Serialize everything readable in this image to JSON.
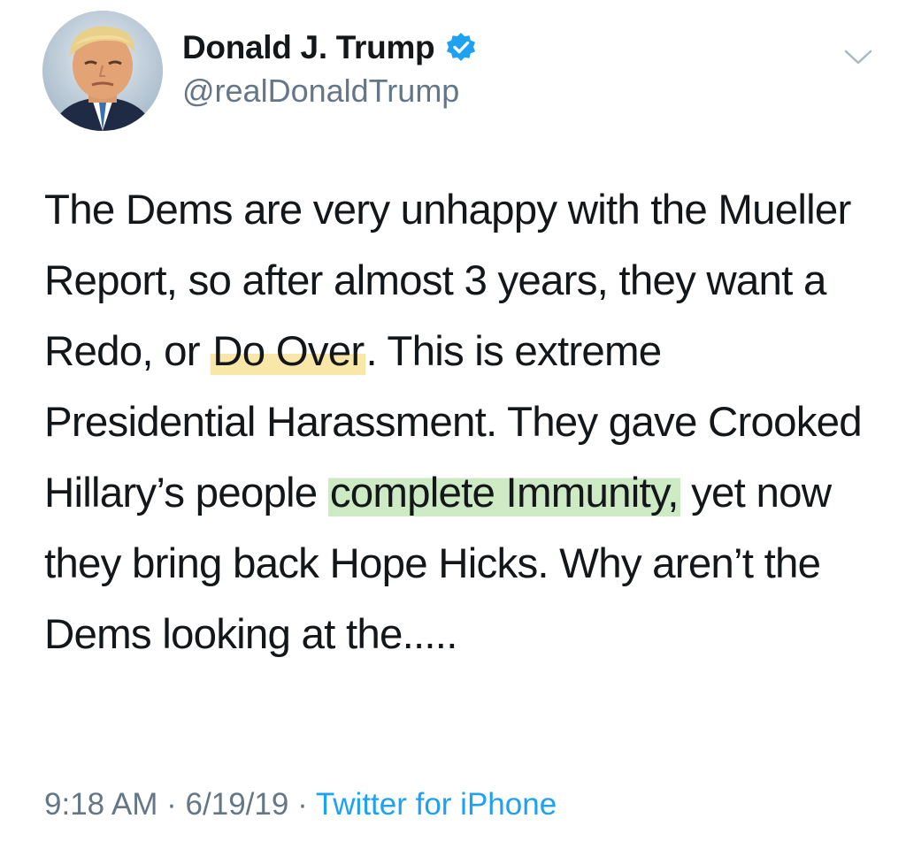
{
  "author": {
    "display_name": "Donald J. Trump",
    "handle": "@realDonaldTrump",
    "verified": true,
    "avatar_icon": "profile-photo-avatar"
  },
  "tweet": {
    "segments": [
      "The Dems are very unhappy with the Mueller Report, so after almost 3 years, they want a Redo, or ",
      "Do Over",
      ". This is extreme Presidential Harassment. They gave Crooked Hillary’s people ",
      "complete Immunity,",
      " yet now they bring back Hope Hicks. Why aren’t the Dems looking at the....."
    ]
  },
  "meta": {
    "time": "9:18 AM",
    "separator": "·",
    "date": "6/19/19",
    "source": "Twitter for iPhone"
  },
  "colors": {
    "accent": "#1da1f2",
    "verified_badge": "#1da1f2",
    "secondary_text": "#657786",
    "highlight_yellow": "#f7de8c",
    "highlight_green": "#c4e7ba"
  },
  "icons": {
    "menu": "chevron-down-icon",
    "verified": "verified-badge-icon"
  }
}
